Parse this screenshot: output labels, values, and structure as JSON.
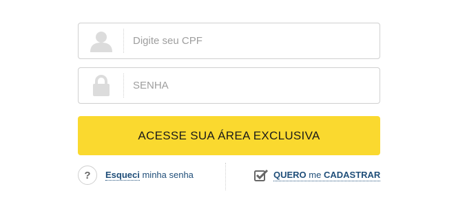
{
  "cpf": {
    "placeholder": "Digite seu CPF",
    "icon": "user-icon"
  },
  "password": {
    "placeholder": "SENHA",
    "icon": "lock-icon"
  },
  "submit": {
    "label": "ACESSE SUA ÁREA EXCLUSIVA",
    "color": "#fad92f"
  },
  "help": {
    "glyph": "?",
    "icon": "question-icon"
  },
  "forgot": {
    "strong": "Esqueci",
    "rest": " minha senha"
  },
  "register": {
    "icon": "checkbox-check-icon",
    "part1": "QUERO",
    "part2": " me ",
    "part3": "CADASTRAR"
  },
  "colors": {
    "link": "#1f4e79",
    "border": "#cfcfcf",
    "icon": "#dcdcdc"
  }
}
